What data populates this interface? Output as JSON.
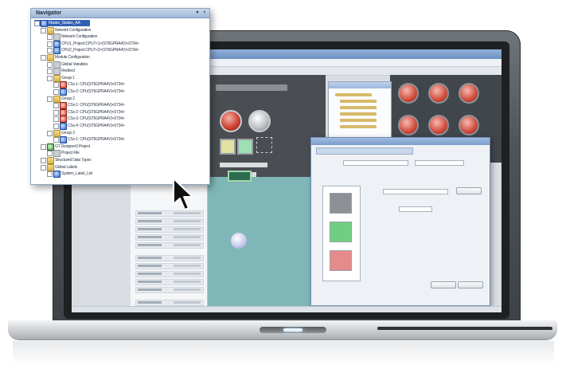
{
  "navigator": {
    "title": "Navigator",
    "close_glyph": "×",
    "pin_glyph": "▾",
    "tree": [
      {
        "label": "Master_Station_AA",
        "level": 0,
        "icon": "blue",
        "selected": true
      },
      {
        "label": "Network Configuration",
        "level": 1,
        "icon": "folder"
      },
      {
        "label": "Network Configuration",
        "level": 2,
        "icon": "grey"
      },
      {
        "label": "CPU1_Project:CPU7<1>(ST6GPRA4V)<0734>",
        "level": 2,
        "icon": "blue"
      },
      {
        "label": "CPU2_Project:CPU7<2>(ST6GPRA4V)<0734>",
        "level": 2,
        "icon": "blue"
      },
      {
        "label": "Module Configuration",
        "level": 1,
        "icon": "folder"
      },
      {
        "label": "Global Variables",
        "level": 2,
        "icon": "grey"
      },
      {
        "label": "Redirect",
        "level": 2,
        "icon": "grey"
      },
      {
        "label": "Group 1",
        "level": 2,
        "icon": "folder"
      },
      {
        "label": "CSx-1: CPU(ST6GPRA4V)<0734>",
        "level": 3,
        "icon": "red"
      },
      {
        "label": "CSx-2: CPU(ST6GPRA4V)<0734>",
        "level": 3,
        "icon": "blue"
      },
      {
        "label": "Group 2",
        "level": 2,
        "icon": "folder"
      },
      {
        "label": "CSx-1: CPU(ST6GPRA4V)<0734>",
        "level": 3,
        "icon": "red"
      },
      {
        "label": "CSx-2: CPU(ST6GPRA4V)<0734>",
        "level": 3,
        "icon": "red"
      },
      {
        "label": "CSx-3: CPU(ST6GPRA4V)<0734>",
        "level": 3,
        "icon": "red"
      },
      {
        "label": "CSx-4: CPU(ST6GPRA4V)<0734>",
        "level": 3,
        "icon": "blue"
      },
      {
        "label": "Group 3",
        "level": 2,
        "icon": "folder"
      },
      {
        "label": "CSx-1: CPU(ST6GPRA4V)<0734>",
        "level": 3,
        "icon": "blue"
      },
      {
        "label": "GT Designer3 Project",
        "level": 1,
        "icon": "green"
      },
      {
        "label": "Project File",
        "level": 2,
        "icon": "grey"
      },
      {
        "label": "Structured Data Types",
        "level": 1,
        "icon": "folder"
      },
      {
        "label": "Global Labels",
        "level": 1,
        "icon": "folder"
      },
      {
        "label": "System_Label_List",
        "level": 2,
        "icon": "blue"
      }
    ]
  },
  "icons": {
    "cursor": "mouse-pointer-icon"
  },
  "colors": {
    "selection": "#2f5fb3",
    "panel_border": "#8fa4bf"
  }
}
